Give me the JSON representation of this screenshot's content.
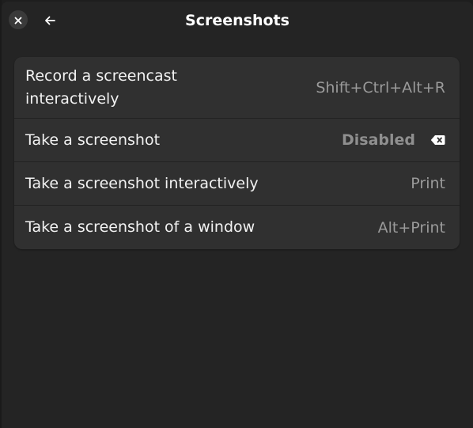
{
  "header": {
    "title": "Screenshots",
    "close_icon": "close-icon",
    "back_icon": "back-arrow-icon"
  },
  "shortcuts": [
    {
      "label_line1": "Record a screencast",
      "label_line2": "interactively",
      "accel": "Shift+Ctrl+Alt+R"
    },
    {
      "label": "Take a screenshot",
      "accel": "Disabled",
      "clear_icon": "clear-shortcut-icon"
    },
    {
      "label": "Take a screenshot interactively",
      "accel": "Print"
    },
    {
      "label": "Take a screenshot of a window",
      "accel": "Alt+Print"
    }
  ],
  "colors": {
    "window_bg": "#242424",
    "row_bg": "#303030",
    "accel_text": "#9a9a9a"
  }
}
